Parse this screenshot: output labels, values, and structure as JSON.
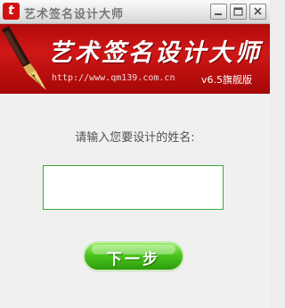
{
  "window": {
    "app_icon_glyph": "t",
    "title": "艺术签名设计大师",
    "buttons": [
      "minimize-icon",
      "maximize-icon",
      "close-icon"
    ]
  },
  "banner": {
    "title": "艺术签名设计大师",
    "url": "http://www.qm139.com.cn",
    "version": "v6.5旗舰版",
    "brand_color": "#c81414"
  },
  "form": {
    "prompt": "请输入您要设计的姓名:",
    "name_value": "",
    "next_label": "下一步",
    "accent_color": "#3aa83a"
  }
}
